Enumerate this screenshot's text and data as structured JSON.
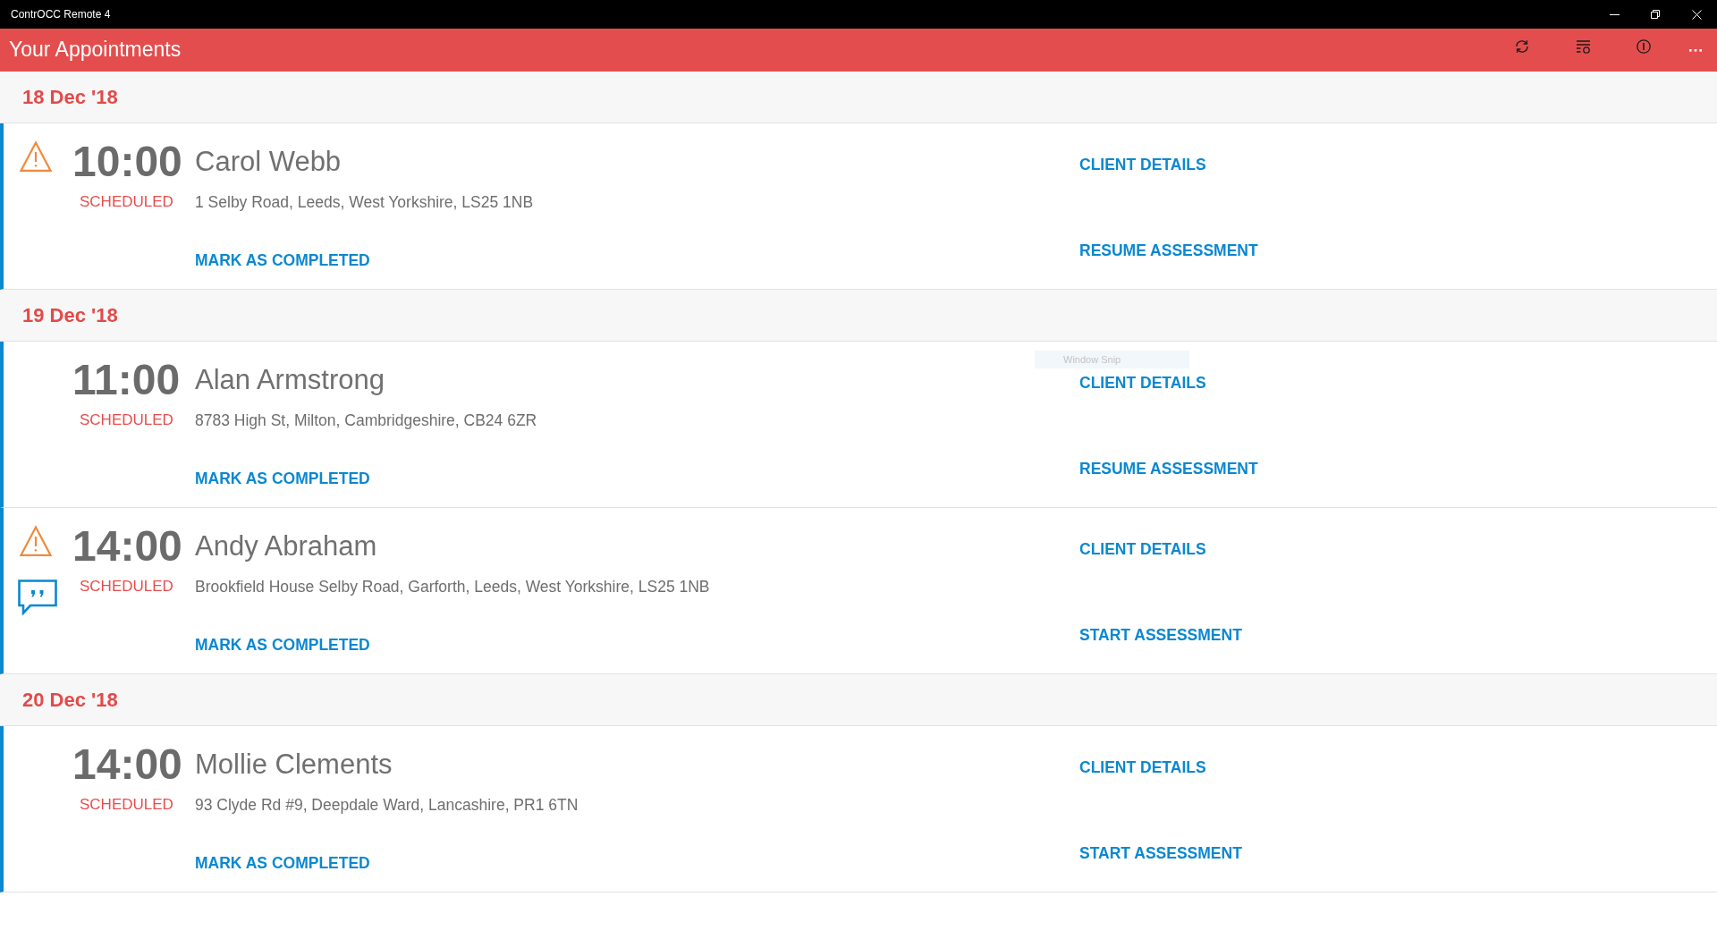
{
  "window": {
    "title": "ContrOCC Remote 4"
  },
  "header": {
    "title": "Your Appointments"
  },
  "days": [
    {
      "date": "18 Dec '18",
      "appointments": [
        {
          "time": "10:00",
          "client": "Carol Webb",
          "status": "SCHEDULED",
          "address": "1 Selby Road, Leeds, West Yorkshire, LS25 1NB",
          "warning": true,
          "note": false,
          "complete_action": "MARK AS COMPLETED",
          "details_action": "CLIENT DETAILS",
          "assessment_action": "RESUME ASSESSMENT"
        }
      ]
    },
    {
      "date": "19 Dec '18",
      "appointments": [
        {
          "time": "11:00",
          "client": "Alan Armstrong",
          "status": "SCHEDULED",
          "address": "8783 High St, Milton, Cambridgeshire, CB24 6ZR",
          "warning": false,
          "note": false,
          "complete_action": "MARK AS COMPLETED",
          "details_action": "CLIENT DETAILS",
          "assessment_action": "RESUME ASSESSMENT"
        },
        {
          "time": "14:00",
          "client": "Andy Abraham",
          "status": "SCHEDULED",
          "address": "Brookfield House Selby Road, Garforth, Leeds, West Yorkshire, LS25 1NB",
          "warning": true,
          "note": true,
          "complete_action": "MARK AS COMPLETED",
          "details_action": "CLIENT DETAILS",
          "assessment_action": "START ASSESSMENT"
        }
      ]
    },
    {
      "date": "20 Dec '18",
      "appointments": [
        {
          "time": "14:00",
          "client": "Mollie Clements",
          "status": "SCHEDULED",
          "address": "93 Clyde Rd #9, Deepdale Ward, Lancashire, PR1 6TN",
          "warning": false,
          "note": false,
          "complete_action": "MARK AS COMPLETED",
          "details_action": "CLIENT DETAILS",
          "assessment_action": "START ASSESSMENT"
        }
      ]
    }
  ],
  "snip_tooltip": {
    "text": "Window Snip"
  }
}
